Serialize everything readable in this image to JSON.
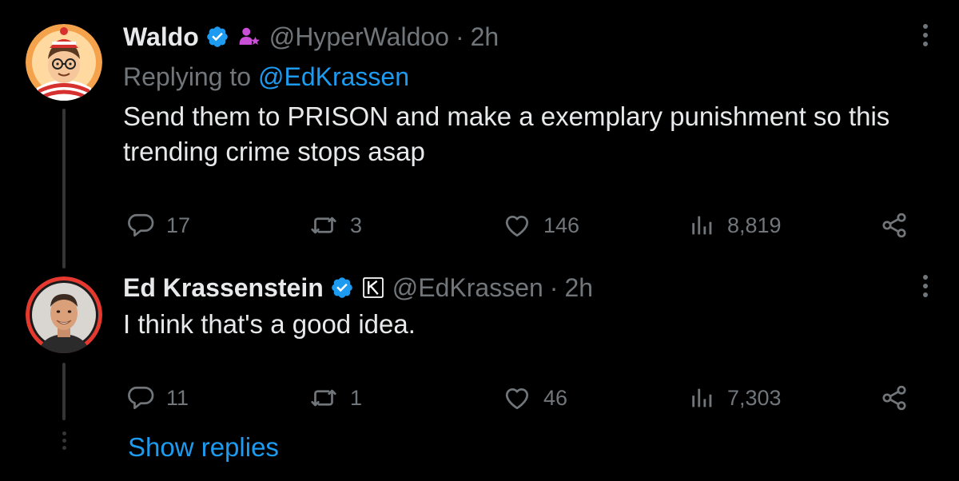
{
  "tweets": [
    {
      "display_name": "Waldo",
      "handle": "@HyperWaldoo",
      "separator": "·",
      "time": "2h",
      "replying_prefix": "Replying to",
      "replying_to": "@EdKrassen",
      "text": "Send them to PRISON and make a exemplary punishment so this trending crime stops asap",
      "replies": "17",
      "reposts": "3",
      "likes": "146",
      "views": "8,819",
      "avatar_icon": "waldo-avatar",
      "extra_badge_icon": "affiliate-person-icon"
    },
    {
      "display_name": "Ed Krassenstein",
      "handle": "@EdKrassen",
      "separator": "·",
      "time": "2h",
      "text": "I think that's a good idea.",
      "replies": "11",
      "reposts": "1",
      "likes": "46",
      "views": "7,303",
      "avatar_icon": "ed-avatar",
      "extra_badge_icon": "k-logo-badge"
    }
  ],
  "show_replies_label": "Show replies",
  "colors": {
    "background": "#000000",
    "text_primary": "#e7e9ea",
    "text_secondary": "#71767b",
    "accent": "#1d9bf0",
    "thread_line": "#333639",
    "verified": "#1d9bf0",
    "affiliate_badge": "#c94fd6"
  }
}
